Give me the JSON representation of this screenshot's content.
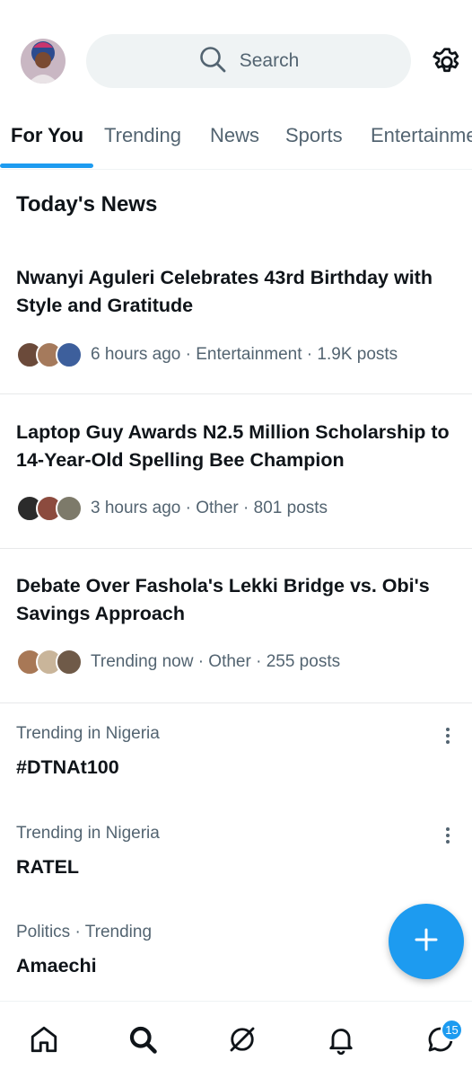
{
  "search": {
    "placeholder": "Search"
  },
  "tabs": [
    {
      "label": "For You",
      "active": true
    },
    {
      "label": "Trending"
    },
    {
      "label": "News"
    },
    {
      "label": "Sports"
    },
    {
      "label": "Entertainment"
    }
  ],
  "section_title": "Today's News",
  "news": [
    {
      "headline": "Nwanyi Aguleri Celebrates 43rd Birthday with Style and Gratitude",
      "meta": "6 hours ago · Entertainment · 1.9K posts"
    },
    {
      "headline": "Laptop Guy Awards N2.5 Million Scholarship to 14-Year-Old Spelling Bee Champion",
      "meta": "3 hours ago · Other · 801 posts"
    },
    {
      "headline": "Debate Over Fashola's Lekki Bridge vs. Obi's Savings Approach",
      "meta": "Trending now · Other · 255 posts"
    }
  ],
  "trends": [
    {
      "context": "Trending in Nigeria",
      "title": "#DTNAt100",
      "has_more": true
    },
    {
      "context": "Trending in Nigeria",
      "title": "RATEL",
      "has_more": true
    },
    {
      "context": "Politics · Trending",
      "title": "Amaechi",
      "has_more": false
    }
  ],
  "bottom_nav": {
    "icons": [
      "home-icon",
      "search-icon",
      "grok-icon",
      "bell-icon",
      "messages-icon"
    ],
    "messages_badge": "15"
  },
  "colors": {
    "accent": "#1d9bf0",
    "text": "#0f1419",
    "secondary": "#536471"
  }
}
